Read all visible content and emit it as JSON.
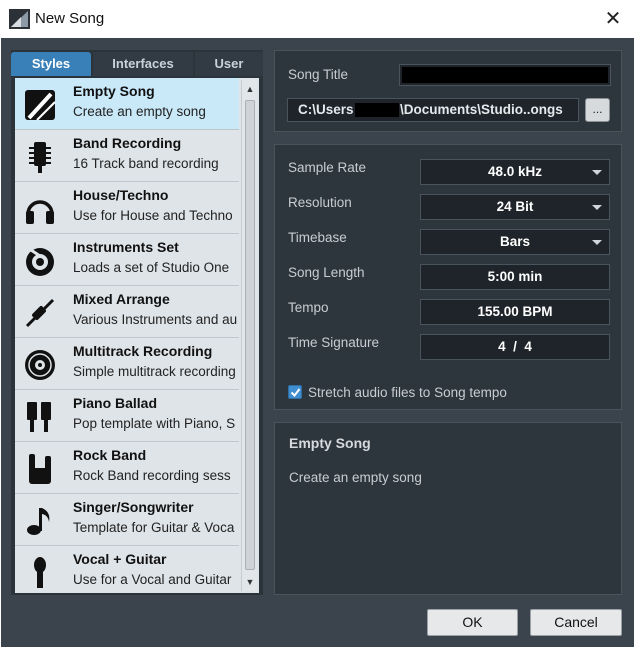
{
  "window": {
    "title": "New Song",
    "app_icon": "studio-one-icon",
    "close_glyph": "✕"
  },
  "tabs": [
    {
      "label": "Styles",
      "active": true
    },
    {
      "label": "Interfaces",
      "active": false
    },
    {
      "label": "User",
      "active": false
    }
  ],
  "templates": [
    {
      "name": "Empty Song",
      "desc": "Create an empty song",
      "icon": "empty-song-icon",
      "selected": true
    },
    {
      "name": "Band Recording",
      "desc": "16 Track band recording",
      "icon": "microphone-grille-icon"
    },
    {
      "name": "House/Techno",
      "desc": "Use for House and Techno",
      "icon": "headphones-icon"
    },
    {
      "name": "Instruments Set",
      "desc": "Loads a set of  Studio One",
      "icon": "instrument-knob-icon"
    },
    {
      "name": "Mixed Arrange",
      "desc": "Various Instruments and au",
      "icon": "audio-jack-icon"
    },
    {
      "name": "Multitrack Recording",
      "desc": "Simple multitrack recording",
      "icon": "disc-icon"
    },
    {
      "name": "Piano Ballad",
      "desc": "Pop template with Piano, S",
      "icon": "piano-keys-icon"
    },
    {
      "name": "Rock Band",
      "desc": "Rock Band recording sess",
      "icon": "rock-hand-icon"
    },
    {
      "name": "Singer/Songwriter",
      "desc": "Template for Guitar & Voca",
      "icon": "music-note-icon"
    },
    {
      "name": "Vocal + Guitar",
      "desc": "Use for a Vocal and Guitar",
      "icon": "microphone-icon"
    }
  ],
  "song": {
    "title_label": "Song Title",
    "title_value": "",
    "path_prefix": "C:\\Users",
    "path_suffix": "\\Documents\\Studio..ongs",
    "browse_label": "..."
  },
  "settings": [
    {
      "label": "Sample Rate",
      "value": "48.0 kHz",
      "dropdown": true
    },
    {
      "label": "Resolution",
      "value": "24 Bit",
      "dropdown": true
    },
    {
      "label": "Timebase",
      "value": "Bars",
      "dropdown": true
    },
    {
      "label": "Song Length",
      "value": "5:00 min",
      "dropdown": false
    },
    {
      "label": "Tempo",
      "value": "155.00 BPM",
      "dropdown": false
    },
    {
      "label": "Time Signature",
      "value": "4  /  4",
      "dropdown": false
    }
  ],
  "stretch": {
    "label": "Stretch audio files to Song tempo",
    "checked": true
  },
  "info": {
    "name": "Empty Song",
    "desc": "Create an empty song"
  },
  "buttons": {
    "ok": "OK",
    "cancel": "Cancel"
  },
  "colors": {
    "accent": "#3a80b8",
    "selected_row": "#c9e8f8",
    "dialog_bg": "#3b444c"
  }
}
